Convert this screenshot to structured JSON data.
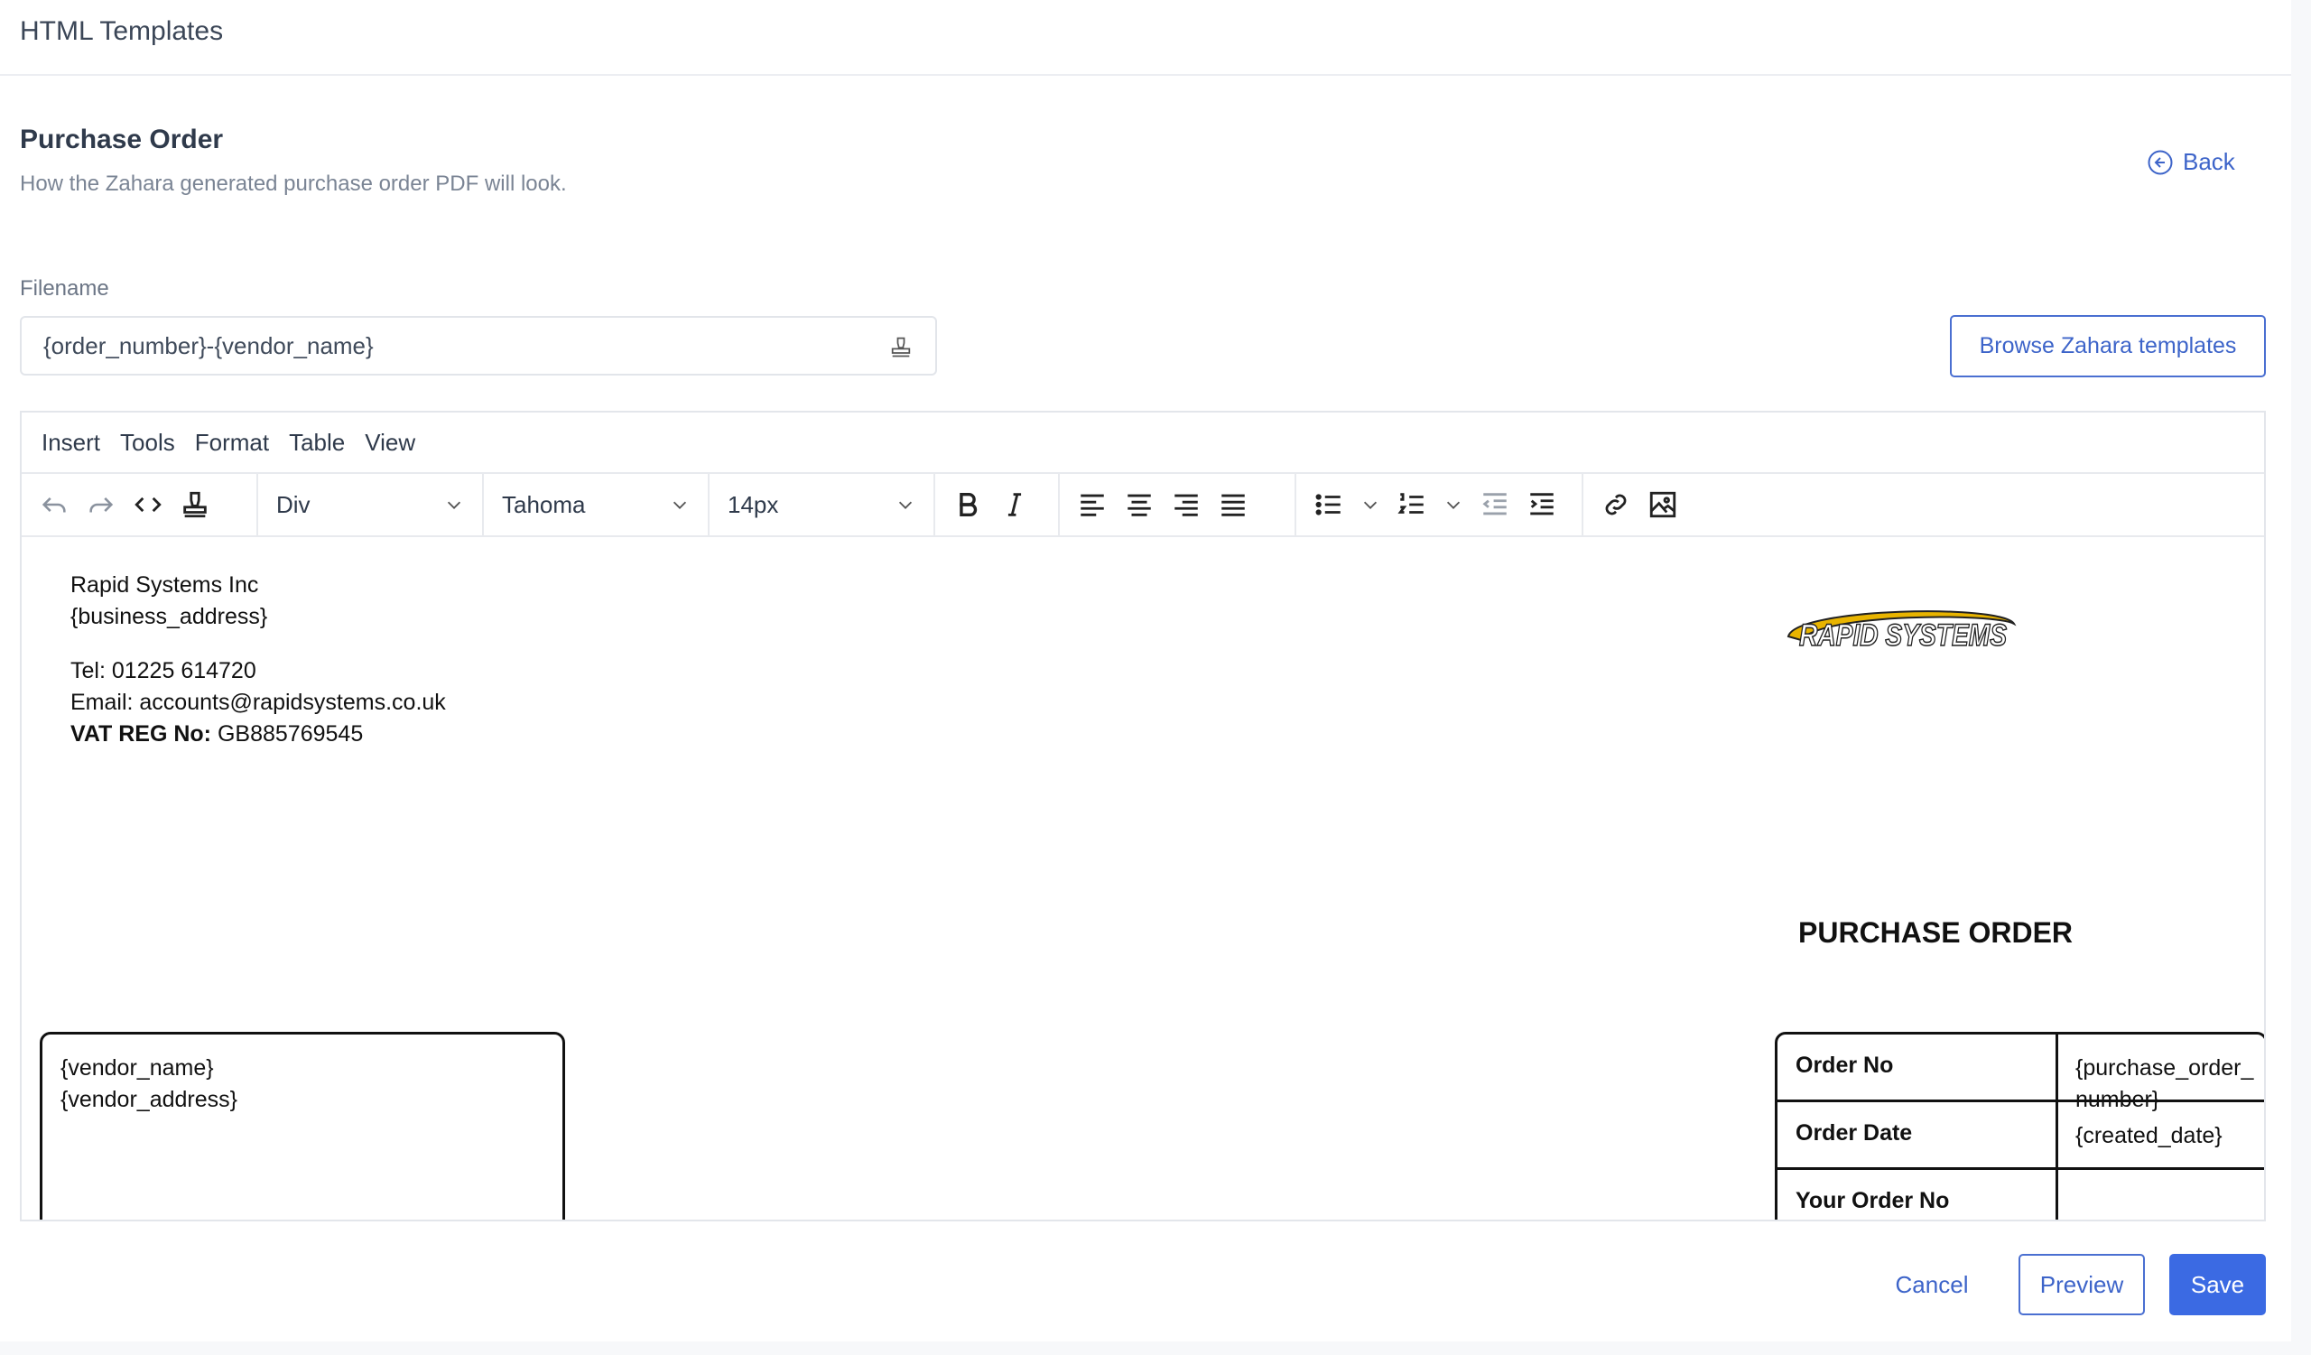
{
  "header": {
    "title": "HTML Templates"
  },
  "section": {
    "title": "Purchase Order",
    "subtitle": "How the Zahara generated purchase order PDF will look.",
    "back_label": "Back"
  },
  "filename": {
    "label": "Filename",
    "value": "{order_number}-{vendor_name}"
  },
  "browse_button": "Browse Zahara templates",
  "editor": {
    "menu": [
      "Insert",
      "Tools",
      "Format",
      "Table",
      "View"
    ],
    "toolbar": {
      "block_format": "Div",
      "font_family": "Tahoma",
      "font_size": "14px"
    },
    "document": {
      "company_name": "Rapid Systems Inc",
      "business_address": "{business_address}",
      "tel": "Tel: 01225 614720",
      "email": "Email: accounts@rapidsystems.co.uk",
      "vat_label": "VAT REG No:",
      "vat_value": "GB885769545",
      "logo_text": "RAPID SYSTEMS",
      "po_title": "PURCHASE ORDER",
      "vendor_name": "{vendor_name}",
      "vendor_address": "{vendor_address}",
      "order_table": [
        {
          "label": "Order No",
          "value": "{purchase_order_number}"
        },
        {
          "label": "Order Date",
          "value": "{created_date}"
        },
        {
          "label": "Your Order No",
          "value": ""
        }
      ]
    }
  },
  "actions": {
    "cancel": "Cancel",
    "preview": "Preview",
    "save": "Save"
  },
  "colors": {
    "accent": "#3b6ae3",
    "link": "#3d64c9",
    "text": "#3f4a5a"
  }
}
